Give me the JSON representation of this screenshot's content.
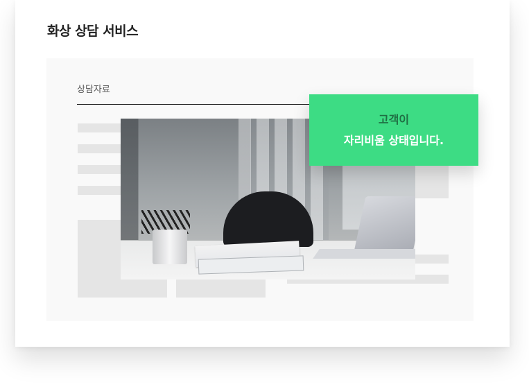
{
  "card": {
    "title": "화상 상담 서비스"
  },
  "panel": {
    "label": "상담자료"
  },
  "notice": {
    "line1": "고객이",
    "line2": "자리비움 상태입니다.",
    "background": "#3ddc84"
  },
  "photo": {
    "icon": "office-desk-photo"
  }
}
